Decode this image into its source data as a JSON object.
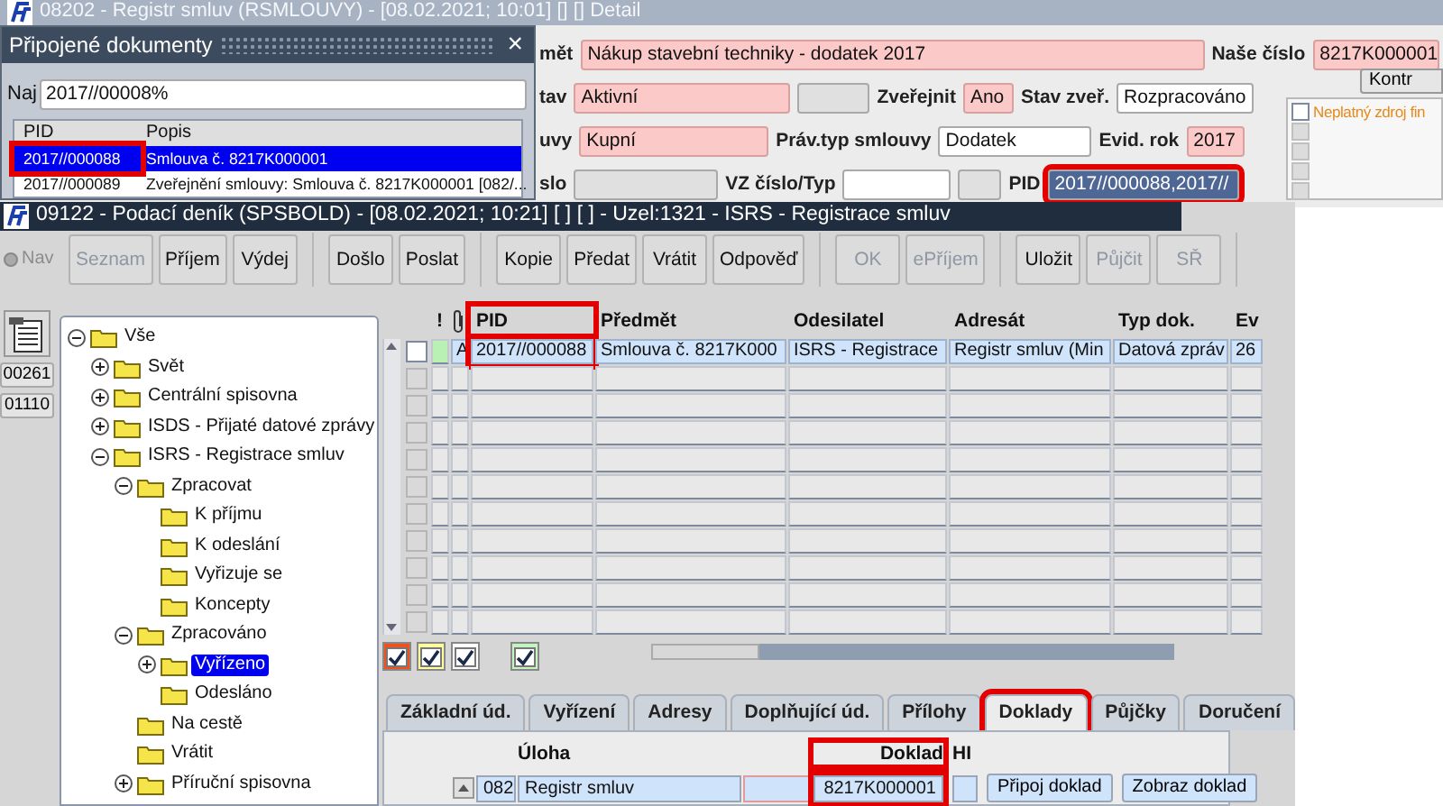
{
  "back_window": {
    "title": "08202 - Registr smluv (RSMLOUVY) - [08.02.2021; 10:01] [] [] Detail",
    "lines": [
      {
        "items": [
          {
            "kind": "label",
            "text": "mět"
          },
          {
            "kind": "field",
            "value": "Nákup stavební techniky - dodatek 2017",
            "required": true,
            "readonly": false,
            "selected": false,
            "highlighted": false
          },
          {
            "kind": "label",
            "text": "Naše číslo"
          },
          {
            "kind": "field",
            "value": "8217K000001",
            "required": true,
            "readonly": false,
            "selected": false,
            "highlighted": false
          }
        ]
      },
      {
        "items": [
          {
            "kind": "label",
            "text": "tav"
          },
          {
            "kind": "field",
            "value": "Aktivní",
            "required": true,
            "readonly": false,
            "selected": false,
            "highlighted": false
          },
          {
            "kind": "field",
            "required": false,
            "readonly": true,
            "selected": false,
            "highlighted": false
          },
          {
            "kind": "label",
            "text": "Zveřejnit"
          },
          {
            "kind": "field",
            "value": "Ano",
            "required": true,
            "readonly": false,
            "selected": false,
            "highlighted": false
          },
          {
            "kind": "label",
            "text": "Stav zveř."
          },
          {
            "kind": "field",
            "value": "Rozpracováno",
            "required": false,
            "readonly": false,
            "selected": false,
            "highlighted": false
          }
        ]
      },
      {
        "items": [
          {
            "kind": "label",
            "text": "uvy"
          },
          {
            "kind": "field",
            "value": "Kupní",
            "required": true,
            "readonly": false,
            "selected": false,
            "highlighted": false
          },
          {
            "kind": "label",
            "text": "Práv.typ smlouvy"
          },
          {
            "kind": "field",
            "value": "Dodatek",
            "required": false,
            "readonly": false,
            "selected": false,
            "highlighted": false
          },
          {
            "kind": "label",
            "text": "Evid. rok"
          },
          {
            "kind": "field",
            "value": "2017",
            "required": true,
            "readonly": false,
            "selected": false,
            "highlighted": false
          }
        ]
      },
      {
        "items": [
          {
            "kind": "label",
            "text": "slo"
          },
          {
            "kind": "field",
            "required": false,
            "readonly": true,
            "selected": false,
            "highlighted": false
          },
          {
            "kind": "label",
            "text": "VZ číslo/Typ"
          },
          {
            "kind": "field",
            "required": false,
            "readonly": false,
            "selected": false,
            "highlighted": false
          },
          {
            "kind": "field",
            "required": false,
            "readonly": true,
            "selected": false,
            "highlighted": false
          },
          {
            "kind": "label",
            "text": "PID"
          },
          {
            "kind": "field",
            "value": "2017//000088,2017//",
            "required": false,
            "readonly": false,
            "selected": true,
            "highlighted": true
          }
        ]
      }
    ],
    "panel_button": "Kontr",
    "checks": [
      {
        "label": "Neplatný zdroj fin",
        "checked": false,
        "disabled": false
      },
      {
        "checked": false,
        "disabled": true
      },
      {
        "checked": false,
        "disabled": true
      },
      {
        "checked": false,
        "disabled": true
      },
      {
        "checked": false,
        "disabled": true
      }
    ]
  },
  "popup": {
    "title": "Připojené dokumenty",
    "close": "×",
    "search_label": "Naj",
    "search_value": "2017//00008%",
    "columns": [
      "PID",
      "Popis"
    ],
    "rows": [
      {
        "pid": "2017//000088",
        "description": "Smlouva č. 8217K000001",
        "selected": true,
        "highlighted": true
      },
      {
        "pid": "2017//000089",
        "description": "Zveřejnění smlouvy: Smlouva č. 8217K000001 [082/...",
        "selected": false,
        "highlighted": false
      }
    ]
  },
  "front_window": {
    "title": "09122 - Podací deník (SPSBOLD) - [08.02.2021; 10:21] [ ] [ ] - Uzel:1321 - ISRS - Registrace smluv",
    "nav": {
      "label": "Nav",
      "disabled": true
    },
    "toolbar": [
      [
        {
          "label": "Seznam",
          "disabled": true
        },
        {
          "label": "Příjem",
          "disabled": false
        },
        {
          "label": "Výdej",
          "disabled": false
        }
      ],
      [
        {
          "label": "Došlo",
          "disabled": false
        },
        {
          "label": "Poslat",
          "disabled": false
        }
      ],
      [
        {
          "label": "Kopie",
          "disabled": false
        },
        {
          "label": "Předat",
          "disabled": false
        },
        {
          "label": "Vrátit",
          "disabled": false
        },
        {
          "label": "Odpověď",
          "disabled": false
        }
      ],
      [
        {
          "label": "OK",
          "disabled": true
        },
        {
          "label": "ePříjem",
          "disabled": true
        }
      ],
      [
        {
          "label": "Uložit",
          "disabled": false
        },
        {
          "label": "Půjčit",
          "disabled": true
        },
        {
          "label": "SŘ",
          "disabled": true
        }
      ]
    ],
    "side_buttons": [
      "00261",
      "01110"
    ],
    "tree": [
      {
        "label": "Vše",
        "expanded": true,
        "selected": false,
        "children": [
          {
            "label": "Svět",
            "expanded": false,
            "selected": false
          },
          {
            "label": "Centrální spisovna",
            "expanded": false,
            "selected": false
          },
          {
            "label": "ISDS - Přijaté datové zprávy",
            "expanded": false,
            "selected": false
          },
          {
            "label": "ISRS - Registrace smluv",
            "expanded": true,
            "selected": false,
            "children": [
              {
                "label": "Zpracovat",
                "expanded": true,
                "selected": false,
                "children": [
                  {
                    "label": "K příjmu",
                    "selected": false
                  },
                  {
                    "label": "K odeslání",
                    "selected": false
                  },
                  {
                    "label": "Vyřizuje se",
                    "selected": false
                  },
                  {
                    "label": "Koncepty",
                    "selected": false
                  }
                ]
              },
              {
                "label": "Zpracováno",
                "expanded": true,
                "selected": false,
                "children": [
                  {
                    "label": "Vyřízeno",
                    "expanded": false,
                    "selected": true
                  },
                  {
                    "label": "Odesláno",
                    "selected": false
                  }
                ]
              },
              {
                "label": "Na cestě",
                "selected": false
              },
              {
                "label": "Vrátit",
                "selected": false
              },
              {
                "label": "Příruční spisovna",
                "expanded": false,
                "selected": false
              }
            ]
          }
        ]
      }
    ],
    "table": {
      "columns": [
        {
          "kind": "flag",
          "label": "!",
          "highlighted": false
        },
        {
          "kind": "attachment",
          "highlighted": false
        },
        {
          "kind": "text",
          "label": "PID",
          "highlighted": true
        },
        {
          "kind": "text",
          "label": "Předmět",
          "highlighted": false
        },
        {
          "kind": "text",
          "label": "Odesilatel",
          "highlighted": false
        },
        {
          "kind": "text",
          "label": "Adresát",
          "highlighted": false
        },
        {
          "kind": "text",
          "label": "Typ dok.",
          "highlighted": false
        },
        {
          "kind": "text",
          "label": "Ev",
          "highlighted": false
        }
      ],
      "rows": [
        {
          "checked": false,
          "disabled": false,
          "selected": true,
          "color": "#b9f0b4",
          "cells": [
            "A",
            "2017//000088",
            "Smlouva č. 8217K000",
            "ISRS - Registrace",
            "Registr smluv (Min",
            "Datová zpráv",
            "26"
          ]
        },
        {
          "checked": false,
          "disabled": true,
          "selected": false
        },
        {
          "checked": false,
          "disabled": true,
          "selected": false
        },
        {
          "checked": false,
          "disabled": true,
          "selected": false
        },
        {
          "checked": false,
          "disabled": true,
          "selected": false
        },
        {
          "checked": false,
          "disabled": true,
          "selected": false
        },
        {
          "checked": false,
          "disabled": true,
          "selected": false
        },
        {
          "checked": false,
          "disabled": true,
          "selected": false
        },
        {
          "checked": false,
          "disabled": true,
          "selected": false
        },
        {
          "checked": false,
          "disabled": true,
          "selected": false
        },
        {
          "checked": false,
          "disabled": true,
          "selected": false
        }
      ]
    },
    "filters": [
      {
        "color": "#f0501c",
        "checked": true
      },
      {
        "color": "#ffff9c",
        "checked": true
      },
      {
        "color": "#ffffff",
        "checked": true
      },
      {
        "color": "#c4f5c0",
        "checked": true
      }
    ],
    "tabs": [
      {
        "label": "Základní úd.",
        "selected": false,
        "highlighted": false
      },
      {
        "label": "Vyřízení",
        "selected": false,
        "highlighted": false
      },
      {
        "label": "Adresy",
        "selected": false,
        "highlighted": false
      },
      {
        "label": "Doplňující úd.",
        "selected": false,
        "highlighted": false
      },
      {
        "label": "Přílohy",
        "selected": false,
        "highlighted": false
      },
      {
        "label": "Doklady",
        "selected": true,
        "highlighted": true
      },
      {
        "label": "Půjčky",
        "selected": false,
        "highlighted": false
      },
      {
        "label": "Doručení",
        "selected": false,
        "highlighted": false
      }
    ],
    "detail": {
      "columns": [
        {
          "label": "Úloha",
          "highlighted": false
        },
        {
          "label": "Doklad",
          "highlighted": true
        },
        {
          "label": "HI",
          "highlighted": false
        }
      ],
      "rows": [
        {
          "code": "082",
          "task": "Registr smluv",
          "document": "8217K000001",
          "highlighted": true
        }
      ],
      "buttons": [
        "Připoj doklad",
        "Zobraz doklad"
      ]
    }
  }
}
